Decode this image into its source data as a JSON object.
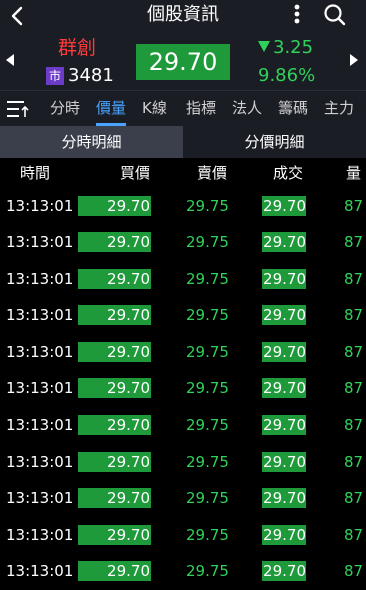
{
  "header": {
    "title": "個股資訊",
    "icons": [
      "back-icon",
      "more-vertical-icon",
      "search-icon"
    ]
  },
  "stock": {
    "name": "群創",
    "market_badge": "市",
    "code": "3481",
    "price": "29.70",
    "change": "3.25",
    "change_pct": "9.86%",
    "change_direction": "down"
  },
  "tabs": {
    "items": [
      "分時",
      "價量",
      "K線",
      "指標",
      "法人",
      "籌碼",
      "主力"
    ],
    "active": "價量"
  },
  "subtabs": {
    "items": [
      "分時明細",
      "分價明細"
    ],
    "active": "分時明細"
  },
  "table": {
    "columns": [
      "時間",
      "買價",
      "賣價",
      "成交",
      "量"
    ],
    "rows": [
      {
        "time": "13:13:01",
        "bid": "29.70",
        "ask": "29.75",
        "trade": "29.70",
        "vol": "87"
      },
      {
        "time": "13:13:01",
        "bid": "29.70",
        "ask": "29.75",
        "trade": "29.70",
        "vol": "87"
      },
      {
        "time": "13:13:01",
        "bid": "29.70",
        "ask": "29.75",
        "trade": "29.70",
        "vol": "87"
      },
      {
        "time": "13:13:01",
        "bid": "29.70",
        "ask": "29.75",
        "trade": "29.70",
        "vol": "87"
      },
      {
        "time": "13:13:01",
        "bid": "29.70",
        "ask": "29.75",
        "trade": "29.70",
        "vol": "87"
      },
      {
        "time": "13:13:01",
        "bid": "29.70",
        "ask": "29.75",
        "trade": "29.70",
        "vol": "87"
      },
      {
        "time": "13:13:01",
        "bid": "29.70",
        "ask": "29.75",
        "trade": "29.70",
        "vol": "87"
      },
      {
        "time": "13:13:01",
        "bid": "29.70",
        "ask": "29.75",
        "trade": "29.70",
        "vol": "87"
      },
      {
        "time": "13:13:01",
        "bid": "29.70",
        "ask": "29.75",
        "trade": "29.70",
        "vol": "87"
      },
      {
        "time": "13:13:01",
        "bid": "29.70",
        "ask": "29.75",
        "trade": "29.70",
        "vol": "87"
      },
      {
        "time": "13:13:01",
        "bid": "29.70",
        "ask": "29.75",
        "trade": "29.70",
        "vol": "87"
      }
    ]
  },
  "colors": {
    "up_green": "#2fd25a",
    "bar_green": "#1f9a3a",
    "name_red": "#ff3b3b",
    "active_blue": "#4aa3ff",
    "badge_purple": "#6c3cc8"
  }
}
